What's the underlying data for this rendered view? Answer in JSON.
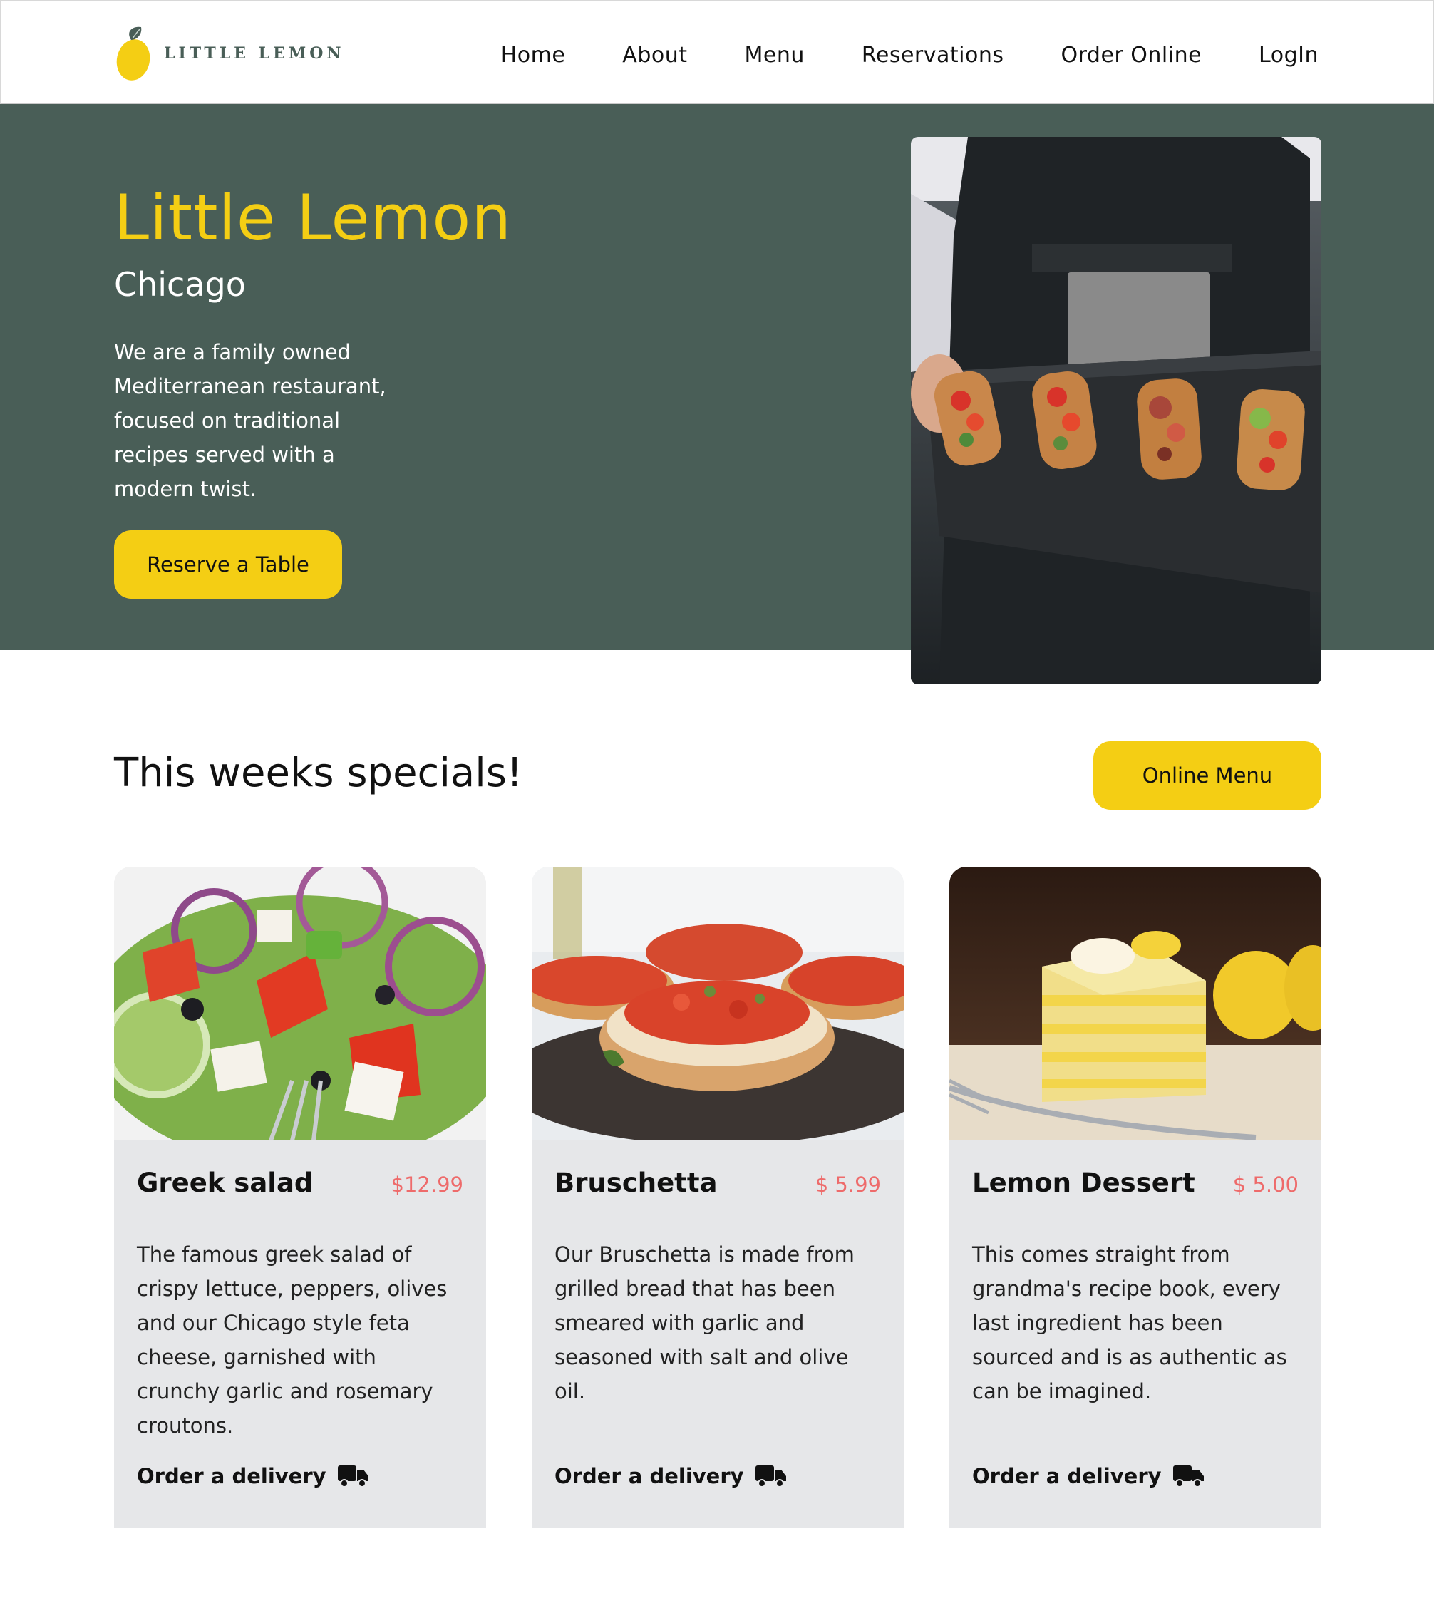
{
  "nav": {
    "logo_text": "LITTLE LEMON",
    "links": [
      "Home",
      "About",
      "Menu",
      "Reservations",
      "Order Online",
      "LogIn"
    ]
  },
  "hero": {
    "title": "Little Lemon",
    "subtitle": "Chicago",
    "description": "We are a family owned Mediterranean restaurant, focused on traditional recipes served with a modern twist.",
    "button": "Reserve a Table"
  },
  "specials": {
    "title": "This weeks specials!",
    "button": "Online Menu",
    "cards": [
      {
        "name": "Greek salad",
        "price": "$12.99",
        "description": "The famous greek salad of crispy lettuce, peppers, olives and our Chicago style feta cheese, garnished with crunchy garlic and rosemary croutons.",
        "order": "Order a delivery"
      },
      {
        "name": "Bruschetta",
        "price": "$ 5.99",
        "description": "Our Bruschetta is made from grilled bread that has been smeared with garlic and seasoned with salt and olive oil.",
        "order": "Order a delivery"
      },
      {
        "name": "Lemon Dessert",
        "price": "$ 5.00",
        "description": "This comes straight from grandma's recipe book, every last ingredient has been sourced and is as authentic as can be imagined.",
        "order": "Order a delivery"
      }
    ]
  },
  "colors": {
    "primary_green": "#495e57",
    "primary_yellow": "#f4ce14",
    "price_red": "#ee6b6b",
    "card_bg": "#e6e7e9"
  },
  "icons": [
    "lemon-logo-icon",
    "delivery-truck-icon"
  ]
}
